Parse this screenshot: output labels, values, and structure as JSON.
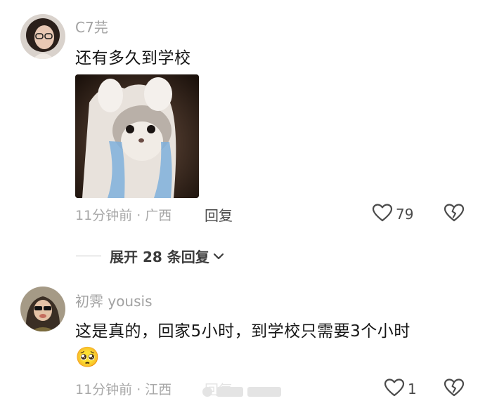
{
  "comments": [
    {
      "username": "C7芫",
      "text": "还有多久到学校",
      "time_location": "11分钟前 · 广西",
      "reply_label": "回复",
      "like_count": "79",
      "has_sticker": true
    },
    {
      "username": "初霁 yousis",
      "text": "这是真的，回家5小时，到学校只需要3个小时",
      "time_location": "11分钟前 · 江西",
      "reply_label": "回复",
      "like_count": "1",
      "emoji": "🥺"
    }
  ],
  "expand_replies": {
    "label": "展开 28 条回复"
  },
  "icons": {
    "like": "heart-outline-icon",
    "dislike": "broken-heart-icon",
    "expand": "chevron-down-icon"
  },
  "colors": {
    "username": "#a1a1a1",
    "meta": "#a8a8a8",
    "text": "#161616"
  }
}
